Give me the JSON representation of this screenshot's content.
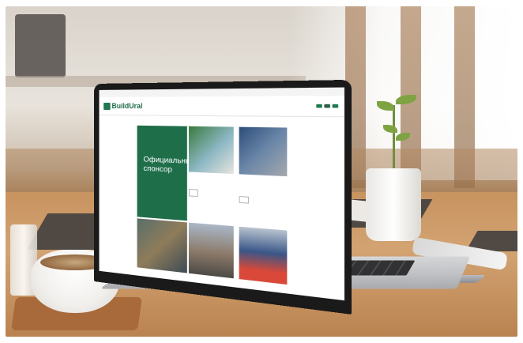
{
  "site": {
    "topbar_text": "",
    "logo_text": "BuildUral",
    "menu": [
      "",
      "",
      "",
      "",
      ""
    ],
    "buttons": [
      "",
      "",
      ""
    ],
    "breadcrumbs": [
      "",
      "",
      ""
    ],
    "sponsor_text": "Официальный спонсор"
  },
  "colors": {
    "brand_green": "#1f6e4a",
    "table_wood": "#c7935f",
    "laptop_frame": "#1a1a1a"
  }
}
